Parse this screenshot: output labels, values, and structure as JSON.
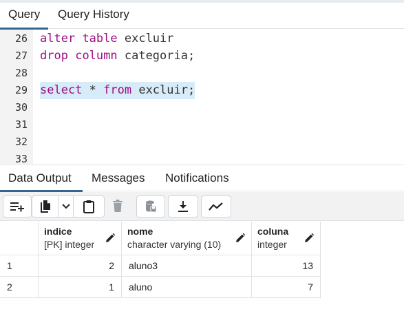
{
  "query_tabs": [
    {
      "label": "Query",
      "active": true
    },
    {
      "label": "Query History",
      "active": false
    }
  ],
  "editor": {
    "lines": [
      {
        "number": "26",
        "tokens": [
          {
            "t": "alter",
            "kw": true
          },
          {
            "t": " "
          },
          {
            "t": "table",
            "kw": true
          },
          {
            "t": " excluir"
          }
        ]
      },
      {
        "number": "27",
        "tokens": [
          {
            "t": "drop",
            "kw": true
          },
          {
            "t": " "
          },
          {
            "t": "column",
            "kw": true
          },
          {
            "t": " categoria;"
          }
        ]
      },
      {
        "number": "28",
        "tokens": []
      },
      {
        "number": "29",
        "selected": true,
        "tokens": [
          {
            "t": "select",
            "kw": true
          },
          {
            "t": " * "
          },
          {
            "t": "from",
            "kw": true
          },
          {
            "t": " excluir;"
          }
        ]
      },
      {
        "number": "30",
        "tokens": []
      },
      {
        "number": "31",
        "tokens": []
      },
      {
        "number": "32",
        "tokens": []
      },
      {
        "number": "33",
        "tokens": []
      }
    ],
    "keyword_color": "#9c0d82",
    "selection_color": "#d7ecf8"
  },
  "result_tabs": [
    {
      "label": "Data Output",
      "active": true
    },
    {
      "label": "Messages",
      "active": false
    },
    {
      "label": "Notifications",
      "active": false
    }
  ],
  "toolbar": {
    "buttons": [
      "add-row-icon",
      "copy-icon",
      "chevron-down-icon",
      "paste-icon",
      "delete-icon",
      "save-data-icon",
      "download-icon",
      "graph-icon"
    ]
  },
  "grid": {
    "columns": [
      {
        "name": "indice",
        "type": "[PK] integer",
        "align": "right"
      },
      {
        "name": "nome",
        "type": "character varying (10)",
        "align": "left"
      },
      {
        "name": "coluna",
        "type": "integer",
        "align": "right"
      }
    ],
    "rows": [
      {
        "n": "1",
        "cells": [
          "2",
          "aluno3",
          "13"
        ]
      },
      {
        "n": "2",
        "cells": [
          "1",
          "aluno",
          "7"
        ]
      }
    ]
  },
  "accent_color": "#326690"
}
